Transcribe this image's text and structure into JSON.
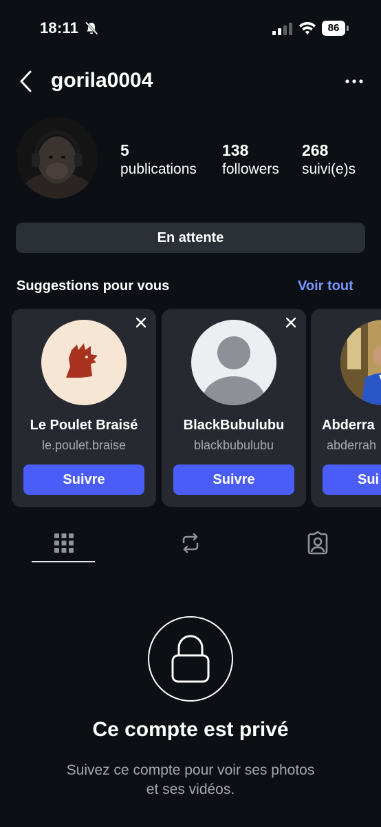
{
  "status_bar": {
    "time": "18:11",
    "battery": "86",
    "icons": [
      "bell-slash-icon",
      "signal-icon",
      "wifi-icon",
      "battery-icon"
    ]
  },
  "header": {
    "username": "gorila0004",
    "back_icon": "chevron-left-icon",
    "more_icon": "ellipsis-icon"
  },
  "profile": {
    "stats": [
      {
        "value": "5",
        "label": "publications"
      },
      {
        "value": "138",
        "label": "followers"
      },
      {
        "value": "268",
        "label": "suivi(e)s"
      }
    ],
    "pending_button": "En attente"
  },
  "suggestions": {
    "title": "Suggestions pour vous",
    "see_all": "Voir tout",
    "cards": [
      {
        "name": "Le Poulet Braisé",
        "handle": "le.poulet.braise",
        "button": "Suivre"
      },
      {
        "name": "BlackBubulubu",
        "handle": "blackbubulubu",
        "button": "Suivre"
      },
      {
        "name": "Abderra",
        "handle": "abderrah",
        "button": "Sui"
      }
    ]
  },
  "tabs": [
    "grid-icon",
    "repost-icon",
    "tagged-icon"
  ],
  "private": {
    "title": "Ce compte est privé",
    "subtitle_line1": "Suivez ce compte pour voir ses photos",
    "subtitle_line2": "et ses vidéos."
  },
  "colors": {
    "background": "#0c0f14",
    "accent_link": "#7896ff",
    "follow_button": "#4a5df9",
    "card": "#262a30"
  }
}
